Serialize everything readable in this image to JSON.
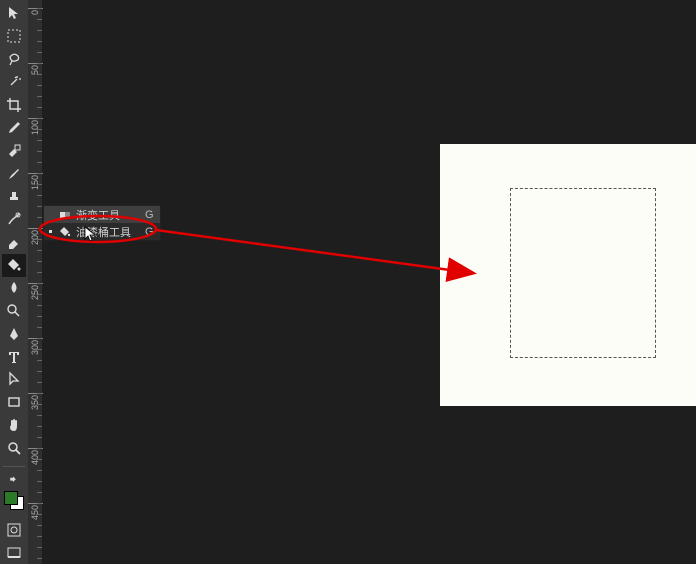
{
  "flyout": {
    "items": [
      {
        "label": "渐变工具",
        "shortcut": "G",
        "selected": false
      },
      {
        "label": "油漆桶工具",
        "shortcut": "G",
        "selected": true
      }
    ]
  },
  "ruler": {
    "labels": [
      "0",
      "50",
      "100",
      "150",
      "200",
      "250",
      "300",
      "350",
      "400",
      "450"
    ]
  },
  "colors": {
    "foreground": "#2a7a2a",
    "background": "#ffffff",
    "annotation": "#e00000"
  },
  "tools": [
    "move-tool",
    "marquee-tool",
    "lasso-tool",
    "magic-wand-tool",
    "crop-tool",
    "eyedropper-tool",
    "spot-healing-tool",
    "brush-tool",
    "clone-stamp-tool",
    "history-brush-tool",
    "eraser-tool",
    "gradient-bucket-tool",
    "blur-tool",
    "dodge-tool",
    "pen-tool",
    "type-tool",
    "path-select-tool",
    "shape-tool",
    "hand-tool",
    "zoom-tool"
  ]
}
